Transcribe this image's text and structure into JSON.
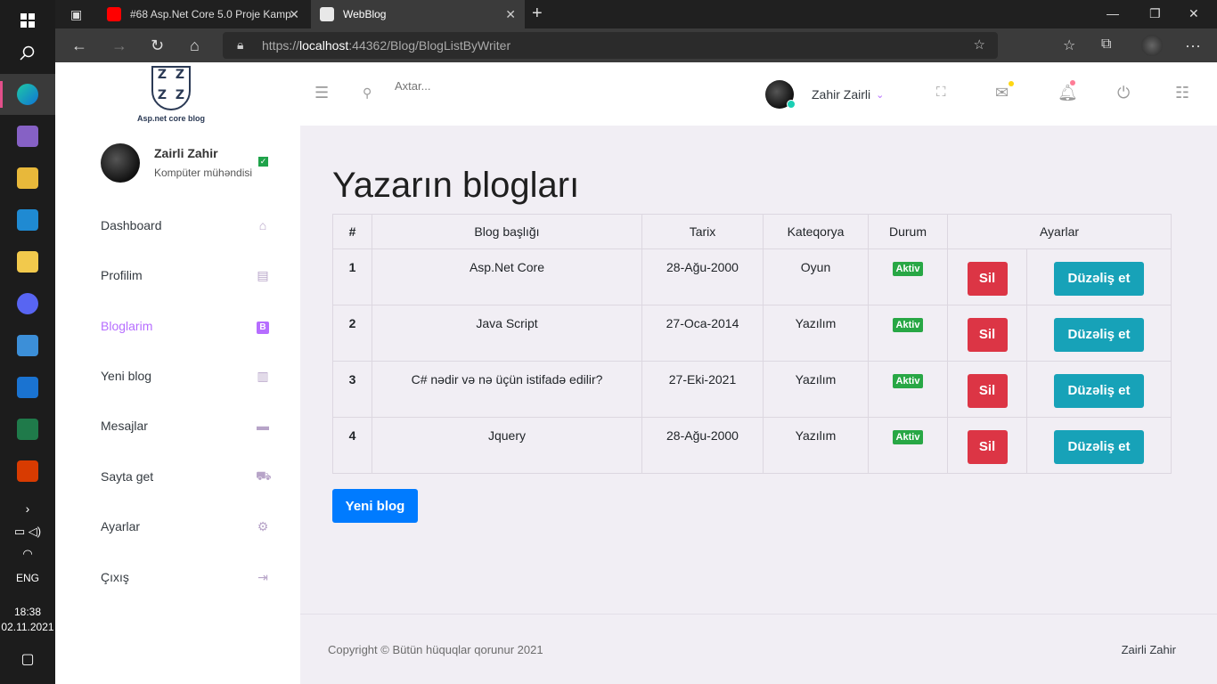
{
  "taskbar": {
    "start_icon": "windows-logo-icon",
    "search_icon": "search-icon",
    "apps": [
      "edge-icon",
      "visual-studio-icon",
      "sql-tool-icon",
      "vscode-icon",
      "file-explorer-icon",
      "discord-icon",
      "remote-desktop-icon",
      "mail-icon",
      "project-icon",
      "office-icon"
    ],
    "language": "ENG",
    "time": "18:38",
    "date": "02.11.2021"
  },
  "browser": {
    "tabs": [
      {
        "title": "#68 Asp.Net Core 5.0 Proje Kamp"
      },
      {
        "title": "WebBlog",
        "active": true
      }
    ],
    "url_prefix": "https://",
    "url_host": "localhost",
    "url_rest": ":44362/Blog/BlogListByWriter"
  },
  "sidebar": {
    "logo_caption": "Asp.net core blog",
    "logo_letters": [
      "Z",
      "Z",
      "Z",
      "Z"
    ],
    "user_name": "Zairli Zahir",
    "user_role": "Kompüter mühəndisi",
    "items": [
      {
        "label": "Dashboard",
        "icon": "home-icon"
      },
      {
        "label": "Profilim",
        "icon": "contact-card-icon"
      },
      {
        "label": "Bloglarim",
        "icon": "blogger-icon",
        "active": true
      },
      {
        "label": "Yeni blog",
        "icon": "chart-bar-icon"
      },
      {
        "label": "Mesajlar",
        "icon": "message-icon"
      },
      {
        "label": "Sayta get",
        "icon": "car-icon"
      },
      {
        "label": "Ayarlar",
        "icon": "gear-icon"
      },
      {
        "label": "Çıxış",
        "icon": "logout-icon"
      }
    ]
  },
  "topnav": {
    "search_placeholder": "Axtar...",
    "user_name": "Zahir Zairli",
    "colors": {
      "accent": "#b66dff",
      "mail_dot": "#fed713",
      "bell_dot": "#fe7c96"
    }
  },
  "main": {
    "title": "Yazarın blogları",
    "columns": [
      "#",
      "Blog başlığı",
      "Tarix",
      "Kateqorya",
      "Durum",
      "Ayarlar"
    ],
    "rows": [
      {
        "id": "1",
        "title": "Asp.Net Core",
        "date": "28-Ağu-2000",
        "category": "Oyun",
        "status": "Aktiv"
      },
      {
        "id": "2",
        "title": "Java Script",
        "date": "27-Oca-2014",
        "category": "Yazılım",
        "status": "Aktiv"
      },
      {
        "id": "3",
        "title": "C# nədir və nə üçün istifadə edilir?",
        "date": "27-Eki-2021",
        "category": "Yazılım",
        "status": "Aktiv"
      },
      {
        "id": "4",
        "title": "Jquery",
        "date": "28-Ağu-2000",
        "category": "Yazılım",
        "status": "Aktiv"
      }
    ],
    "delete_label": "Sil",
    "edit_label": "Düzəliş et",
    "new_blog_label": "Yeni blog"
  },
  "footer": {
    "copyright": "Copyright © Bütün hüquqlar qorunur 2021",
    "author": "Zairli Zahir"
  }
}
